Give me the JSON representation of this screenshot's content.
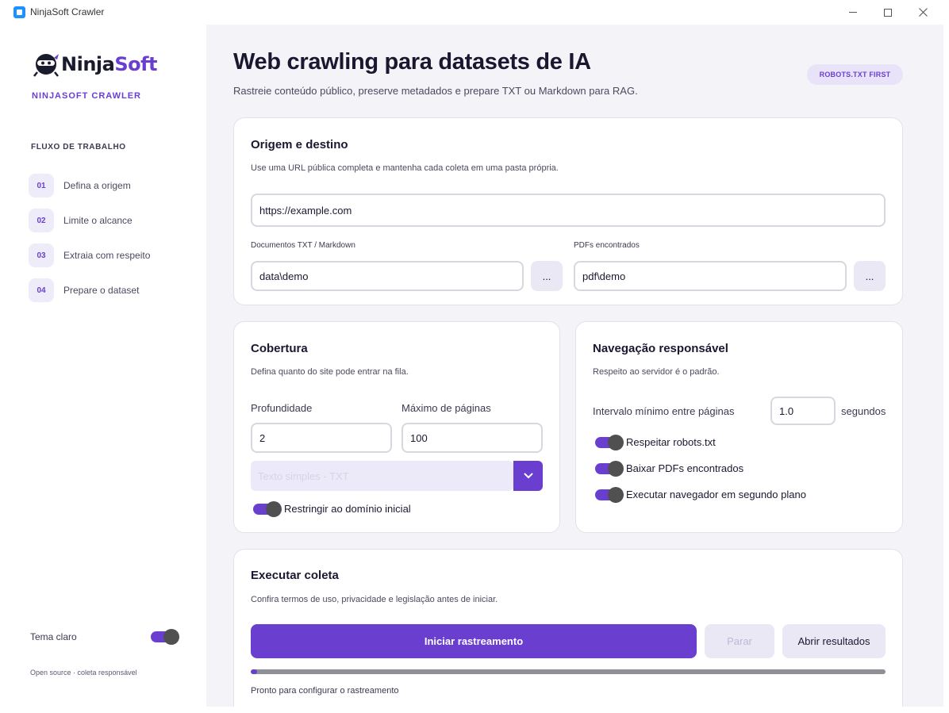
{
  "window": {
    "title": "NinjaSoft Crawler"
  },
  "sidebar": {
    "logo_text_dark": "Ninja",
    "logo_text_accent": "Soft",
    "brand_subtitle": "NINJASOFT CRAWLER",
    "flow_title": "FLUXO DE TRABALHO",
    "steps": [
      {
        "num": "01",
        "label": "Defina a origem"
      },
      {
        "num": "02",
        "label": "Limite o alcance"
      },
      {
        "num": "03",
        "label": "Extraia com respeito"
      },
      {
        "num": "04",
        "label": "Prepare o dataset"
      }
    ],
    "theme_label": "Tema claro",
    "theme_on": true,
    "footer": "Open source · coleta responsável"
  },
  "header": {
    "title": "Web crawling para datasets de IA",
    "subtitle": "Rastreie conteúdo público, preserve metadados e prepare TXT ou Markdown para RAG.",
    "badge": "ROBOTS.TXT FIRST"
  },
  "origin": {
    "title": "Origem e destino",
    "description": "Use uma URL pública completa e mantenha cada coleta em uma pasta própria.",
    "url_value": "https://example.com",
    "docs_label": "Documentos TXT / Markdown",
    "docs_value": "data\\demo",
    "pdfs_label": "PDFs encontrados",
    "pdfs_value": "pdf\\demo",
    "browse_label": "..."
  },
  "coverage": {
    "title": "Cobertura",
    "description": "Defina quanto do site pode entrar na fila.",
    "depth_label": "Profundidade",
    "depth_value": "2",
    "max_pages_label": "Máximo de páginas",
    "max_pages_value": "100",
    "format_value": "Texto simples - TXT",
    "restrict_domain_label": "Restringir ao domínio inicial",
    "restrict_domain_on": true
  },
  "navigation": {
    "title": "Navegação responsável",
    "description": "Respeito ao servidor é o padrão.",
    "interval_label": "Intervalo mínimo entre páginas",
    "interval_value": "1.0",
    "interval_unit": "segundos",
    "toggles": [
      {
        "label": "Respeitar robots.txt",
        "on": true
      },
      {
        "label": "Baixar PDFs encontrados",
        "on": true
      },
      {
        "label": "Executar navegador em segundo plano",
        "on": true
      }
    ]
  },
  "execute": {
    "title": "Executar coleta",
    "description": "Confira termos de uso, privacidade e legislação antes de iniciar.",
    "start_label": "Iniciar rastreamento",
    "stop_label": "Parar",
    "open_results_label": "Abrir resultados",
    "progress": 0.01,
    "status": "Pronto para configurar o rastreamento"
  },
  "colors": {
    "accent": "#6a3fd0",
    "accent_soft": "#ebe8f6",
    "background": "#f4f3f7",
    "toggle_knob": "#505050"
  }
}
